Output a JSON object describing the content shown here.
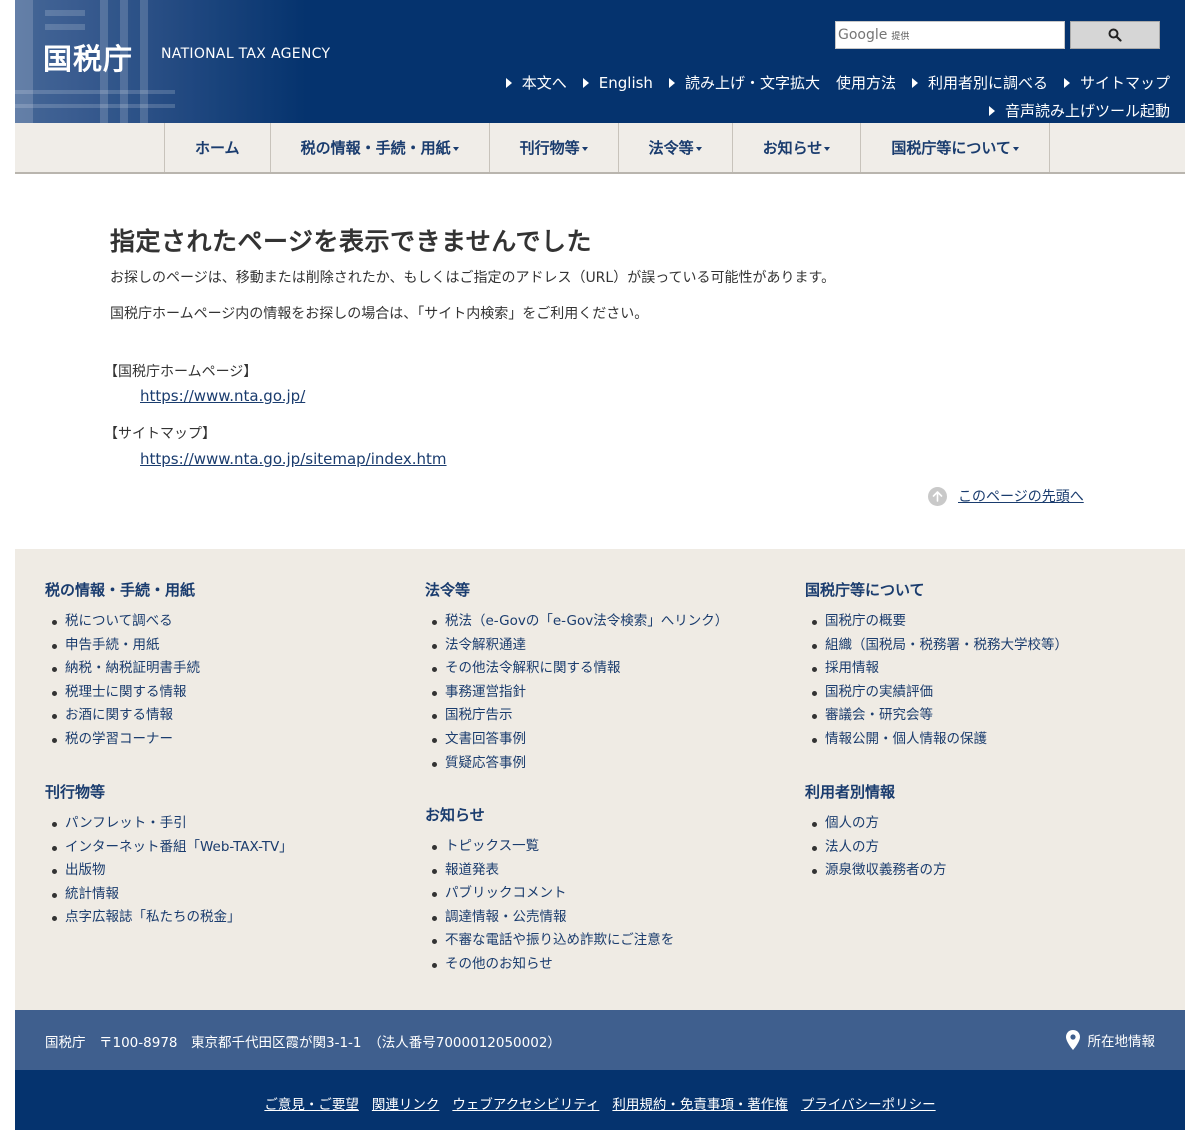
{
  "header": {
    "logo_jp": "国税庁",
    "logo_en": "NATIONAL TAX AGENCY",
    "search": {
      "brand": "Google",
      "brand_suffix": "提供",
      "placeholder": "",
      "button_icon": "search-icon"
    },
    "util_links_row1": [
      "本文へ",
      "English",
      "読み上げ・文字拡大",
      "使用方法",
      "利用者別に調べる",
      "サイトマップ"
    ],
    "util_links_row2": [
      "音声読み上げツール起動"
    ]
  },
  "nav": {
    "items": [
      "ホーム",
      "税の情報・手続・用紙",
      "刊行物等",
      "法令等",
      "お知らせ",
      "国税庁等について"
    ]
  },
  "main": {
    "title": "指定されたページを表示できませんでした",
    "para1": "お探しのページは、移動または削除されたか、もしくはご指定のアドレス（URL）が誤っている可能性があります。",
    "para2": "国税庁ホームページ内の情報をお探しの場合は、「サイト内検索」をご利用ください。",
    "label1": "【国税庁ホームページ】",
    "url1": "https://www.nta.go.jp/",
    "label2": "【サイトマップ】",
    "url2": "https://www.nta.go.jp/sitemap/index.htm",
    "to_top": "このページの先頭へ"
  },
  "footer_map": {
    "col1": {
      "head1": "税の情報・手続・用紙",
      "items1": [
        "税について調べる",
        "申告手続・用紙",
        "納税・納税証明書手続",
        "税理士に関する情報",
        "お酒に関する情報",
        "税の学習コーナー"
      ],
      "head2": "刊行物等",
      "items2": [
        "パンフレット・手引",
        "インターネット番組「Web-TAX-TV」",
        "出版物",
        "統計情報",
        "点字広報誌「私たちの税金」"
      ]
    },
    "col2": {
      "head1": "法令等",
      "items1": [
        "税法（e-Govの「e-Gov法令検索」へリンク）",
        "法令解釈通達",
        "その他法令解釈に関する情報",
        "事務運営指針",
        "国税庁告示",
        "文書回答事例",
        "質疑応答事例"
      ],
      "head2": "お知らせ",
      "items2": [
        "トピックス一覧",
        "報道発表",
        "パブリックコメント",
        "調達情報・公売情報",
        "不審な電話や振り込め詐欺にご注意を",
        "その他のお知らせ"
      ]
    },
    "col3": {
      "head1": "国税庁等について",
      "items1": [
        "国税庁の概要",
        "組織（国税局・税務署・税務大学校等）",
        "採用情報",
        "国税庁の実績評価",
        "審議会・研究会等",
        "情報公開・個人情報の保護"
      ],
      "head2": "利用者別情報",
      "items2": [
        "個人の方",
        "法人の方",
        "源泉徴収義務者の方"
      ]
    }
  },
  "address": {
    "text": "国税庁　〒100-8978　東京都千代田区霞が関3-1-1　（法人番号7000012050002）",
    "location_label": "所在地情報"
  },
  "bottom_links": [
    "ご意見・ご要望",
    "関連リンク",
    "ウェブアクセシビリティ",
    "利用規約・免責事項・著作権",
    "プライバシーポリシー"
  ]
}
